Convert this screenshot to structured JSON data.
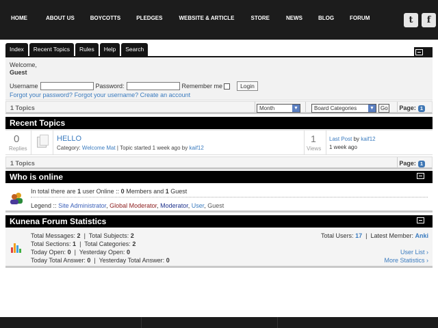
{
  "nav": {
    "items": [
      "HOME",
      "ABOUT US",
      "BOYCOTTS",
      "PLEDGES",
      "WEBSITE & ARTICLE",
      "STORE",
      "NEWS",
      "BLOG",
      "FORUM"
    ],
    "twitter": "t",
    "facebook": "f"
  },
  "tabs": [
    "Index",
    "Recent Topics",
    "Rules",
    "Help",
    "Search"
  ],
  "login": {
    "welcome": "Welcome,",
    "user": "Guest",
    "username_label": "Username",
    "password_label": "Password:",
    "remember_label": "Remember me",
    "login_btn": "Login",
    "forgot_password": "Forgot your password?",
    "forgot_username": "Forgot your username?",
    "create_account": "Create an account"
  },
  "topbar": {
    "count": "1 Topics",
    "period_select": "Month",
    "category_select": "Board Categories",
    "go_btn": "Go",
    "page_label": "Page:",
    "page_num": "1"
  },
  "recent": {
    "title": "Recent Topics",
    "topic": {
      "replies": "0",
      "replies_label": "Replies",
      "title": "HELLO",
      "category_label": "Category:",
      "category": "Welcome Mat",
      "meta": "| Topic started 1 week ago by",
      "author": "kaif12",
      "views": "1",
      "views_label": "Views",
      "last_post_label": "Last Post",
      "last_post_by": "by",
      "last_post_user": "kaif12",
      "last_post_time": "1 week ago"
    }
  },
  "bottombar": {
    "count": "1 Topics",
    "page_label": "Page:",
    "page_num": "1"
  },
  "online": {
    "title": "Who is online",
    "l1_a": "In total there are",
    "users_online": "1",
    "l1_b": "user Online",
    "l1_sep": "::",
    "members": "0",
    "l1_c": "Members and",
    "guests": "1",
    "l1_d": "Guest",
    "legend_label": "Legend ::",
    "legend": [
      {
        "label": "Site Administrator",
        "color": "#3a5fb8"
      },
      {
        "label": "Global Moderator",
        "color": "#8b1a1a"
      },
      {
        "label": "Moderator",
        "color": "#1a2f8b"
      },
      {
        "label": "User",
        "color": "#3a7bbf"
      },
      {
        "label": "Guest",
        "color": "#555555"
      }
    ]
  },
  "stats": {
    "title": "Kunena Forum Statistics",
    "total_messages_label": "Total Messages:",
    "total_messages": "2",
    "total_subjects_label": "Total Subjects:",
    "total_subjects": "2",
    "total_sections_label": "Total Sections:",
    "total_sections": "1",
    "total_categories_label": "Total Categories:",
    "total_categories": "2",
    "today_open_label": "Today Open:",
    "today_open": "0",
    "yesterday_open_label": "Yesterday Open:",
    "yesterday_open": "0",
    "today_answer_label": "Today Total Answer:",
    "today_answer": "0",
    "yesterday_answer_label": "Yesterday Total Answer:",
    "yesterday_answer": "0",
    "total_users_label": "Total Users:",
    "total_users": "17",
    "latest_member_label": "Latest Member:",
    "latest_member": "Anki",
    "user_list": "User List",
    "more_stats": "More Statistics"
  }
}
